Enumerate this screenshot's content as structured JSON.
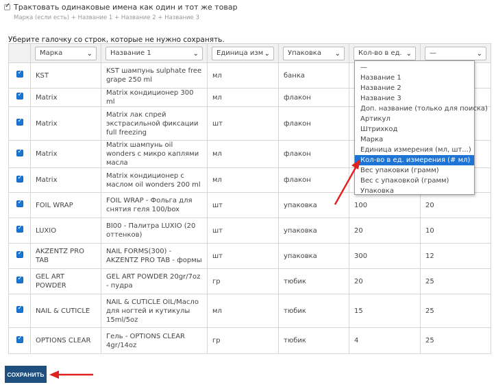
{
  "options": {
    "treat_same_names_label": "Трактовать одинаковые имена как один и тот же товар",
    "treat_same_names_hint": "Марка (если есть) + Название 1 + Название 2 + Название 3"
  },
  "instruction": "Уберите галочку со строк, которые не нужно сохранять.",
  "columns": [
    "Марка",
    "Название 1",
    "Единица изм",
    "Упаковка",
    "Кол-во в ед.",
    "—"
  ],
  "rows": [
    {
      "brand": "KST",
      "name": "KST шампунь sulphate free grape 250 ml",
      "unit": "мл",
      "pack": "банка",
      "qty": "",
      "extra": ""
    },
    {
      "brand": "Matrix",
      "name": "Matrix кондиционер 300 ml",
      "unit": "мл",
      "pack": "флакон",
      "qty": "",
      "extra": ""
    },
    {
      "brand": "Matrix",
      "name": "Matrix лак спрей экстрасильной фиксации full freezing",
      "unit": "шт",
      "pack": "флакон",
      "qty": "",
      "extra": ""
    },
    {
      "brand": "Matrix",
      "name": "Matrix шампунь oil wonders с микро каплями масла",
      "unit": "мл",
      "pack": "флакон",
      "qty": "",
      "extra": ""
    },
    {
      "brand": "Matrix",
      "name": "Matrix кондиционер с маслом oil wonders 200 ml",
      "unit": "мл",
      "pack": "флакон",
      "qty": "",
      "extra": ""
    },
    {
      "brand": "FOIL WRAP",
      "name": "FOIL WRAP - Фольга для снятия геля 100/box",
      "unit": "шт",
      "pack": "упаковка",
      "qty": "100",
      "extra": "20"
    },
    {
      "brand": "LUXIO",
      "name": "BI00 - Палитра LUXIO (20 оттенков)",
      "unit": "шт",
      "pack": "упаковка",
      "qty": "20",
      "extra": "10"
    },
    {
      "brand": "AKZENTZ PRO TAB",
      "name": "NAIL FORMS(300) - AKZENTZ PRO TAB - формы",
      "unit": "шт",
      "pack": "упаковка",
      "qty": "300",
      "extra": "12"
    },
    {
      "brand": "GEL ART POWDER",
      "name": "GEL ART POWDER 20gr/7oz - пудра",
      "unit": "гр",
      "pack": "тюбик",
      "qty": "20",
      "extra": "25"
    },
    {
      "brand": "NAIL & CUTICLE",
      "name": "NAIL & CUTICLE OIL/Масло для ногтей и кутикулы 15ml/5oz",
      "unit": "мл",
      "pack": "тюбик",
      "qty": "15",
      "extra": "25"
    },
    {
      "brand": "OPTIONS CLEAR",
      "name": "Гель - OPTIONS CLEAR 4gr/14oz",
      "unit": "гр",
      "pack": "тюбик",
      "qty": "4",
      "extra": "25"
    }
  ],
  "dropdown": {
    "options": [
      "—",
      "Название 1",
      "Название 2",
      "Название 3",
      "Доп. название (только для поиска)",
      "Артикул",
      "Штрихкод",
      "Марка",
      "Единица измерения (мл, шт...)",
      "Кол-во в ед. измерения (# мл)",
      "Вес упаковки (грамм)",
      "Вес с упаковкой (грамм)",
      "Упаковка"
    ],
    "selected_index": 9
  },
  "save_label": "Сохранить",
  "colors": {
    "accent": "#1e74d4",
    "save_button": "#1f4f7f",
    "arrow": "#e0221f"
  }
}
